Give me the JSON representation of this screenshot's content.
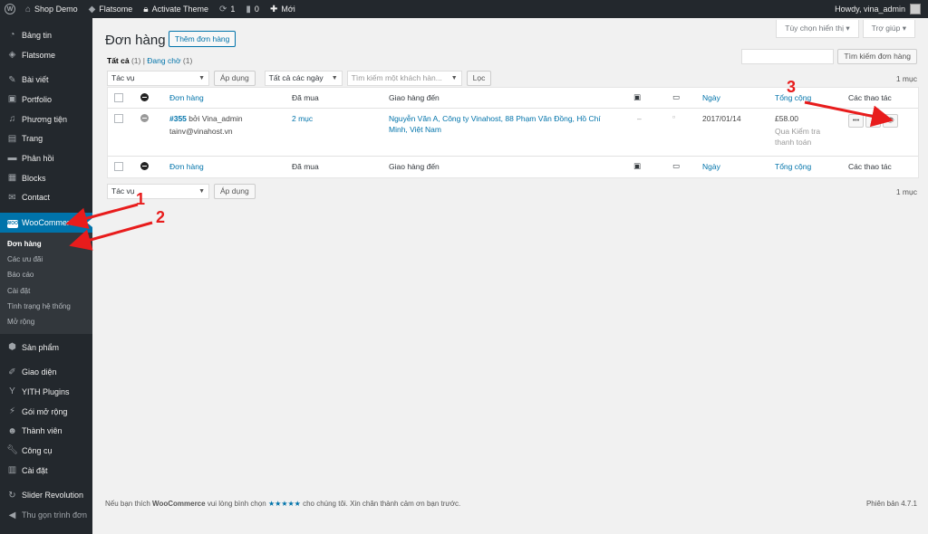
{
  "adminbar": {
    "site": "Shop Demo",
    "theme": "Flatsome",
    "activate": "Activate Theme",
    "updates": "1",
    "comments": "0",
    "new": "Mới",
    "howdy": "Howdy, vina_admin"
  },
  "sidebar": {
    "items": [
      {
        "label": "Bảng tin",
        "icon": "dashboard-icon"
      },
      {
        "label": "Flatsome",
        "icon": "flatsome-icon"
      },
      {
        "label": "Bài viết",
        "icon": "pin-icon"
      },
      {
        "label": "Portfolio",
        "icon": "portfolio-icon"
      },
      {
        "label": "Phương tiện",
        "icon": "media-icon"
      },
      {
        "label": "Trang",
        "icon": "page-icon"
      },
      {
        "label": "Phản hồi",
        "icon": "comment-icon"
      },
      {
        "label": "Blocks",
        "icon": "blocks-icon"
      },
      {
        "label": "Contact",
        "icon": "mail-icon"
      },
      {
        "label": "WooCommerce",
        "icon": "woo-icon"
      },
      {
        "label": "Sản phẩm",
        "icon": "box-icon"
      },
      {
        "label": "Giao diện",
        "icon": "brush-icon"
      },
      {
        "label": "YITH Plugins",
        "icon": "yith-icon"
      },
      {
        "label": "Gói mở rộng",
        "icon": "plugin-icon"
      },
      {
        "label": "Thành viên",
        "icon": "users-icon"
      },
      {
        "label": "Công cụ",
        "icon": "tools-icon"
      },
      {
        "label": "Cài đặt",
        "icon": "settings-icon"
      },
      {
        "label": "Slider Revolution",
        "icon": "slider-icon"
      },
      {
        "label": "Thu gọn trình đơn",
        "icon": "collapse-icon"
      }
    ],
    "woo_badge": "WOO",
    "submenu": [
      "Đơn hàng",
      "Các ưu đãi",
      "Báo cáo",
      "Cài đặt",
      "Tình trạng hệ thống",
      "Mở rộng"
    ]
  },
  "screen": {
    "options": "Tùy chọn hiển thị",
    "help": "Trợ giúp"
  },
  "page": {
    "title": "Đơn hàng",
    "add_button": "Thêm đơn hàng"
  },
  "filters": {
    "all": "Tất cả",
    "all_count": "(1)",
    "pending": "Đang chờ",
    "pending_count": "(1)",
    "search_button": "Tìm kiếm đơn hàng",
    "bulk_action": "Tác vụ",
    "apply": "Áp dụng",
    "dates": "Tất cả các ngày",
    "customer_placeholder": "Tìm kiếm một khách hàn...",
    "filter": "Lọc",
    "count": "1 mục"
  },
  "table": {
    "headers": {
      "order": "Đơn hàng",
      "purchased": "Đã mua",
      "ship_to": "Giao hàng đến",
      "date": "Ngày",
      "total": "Tổng cộng",
      "actions": "Các thao tác"
    },
    "row": {
      "order_link": "#355",
      "order_by": "bởi Vina_admin",
      "email": "tainv@vinahost.vn",
      "purchased": "2 mục",
      "ship_line1": "Nguyễn Văn A, Công ty Vinahost, 88 Phạm Văn Đồng, Hồ Chí",
      "ship_line2": "Minh, Việt Nam",
      "note": "–",
      "date": "2017/01/14",
      "total": "£58.00",
      "pay_line1": "Qua Kiểm tra",
      "pay_line2": "thanh toán",
      "more": "•••",
      "view": "👁"
    }
  },
  "footer": {
    "text_a": "Nếu bạn thích",
    "brand": "WooCommerce",
    "text_b": "vui lòng bình chọn",
    "stars": "★★★★★",
    "text_c": "cho chúng tôi. Xin chân thành cảm ơn bạn trước.",
    "version": "Phiên bản 4.7.1"
  },
  "annotations": [
    "1",
    "2",
    "3"
  ],
  "colors": {
    "accent": "#0073aa",
    "arrow": "#e81c1c",
    "sidebar": "#23282d"
  }
}
